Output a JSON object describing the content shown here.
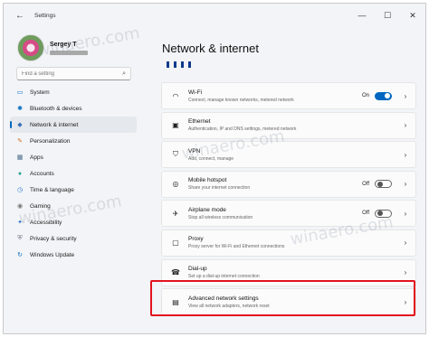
{
  "window": {
    "back_icon": "←",
    "title": "Settings",
    "minimize_icon": "—",
    "maximize_icon": "☐",
    "close_icon": "✕"
  },
  "profile": {
    "name": "Sergey T"
  },
  "search": {
    "placeholder": "Find a setting",
    "icon": "⌕"
  },
  "sidebar": {
    "items": [
      {
        "label": "System",
        "icon": "▭",
        "icon_color": "#0067c0"
      },
      {
        "label": "Bluetooth & devices",
        "icon": "✱",
        "icon_color": "#0067c0"
      },
      {
        "label": "Network & internet",
        "icon": "◆",
        "icon_color": "#3b6fb6"
      },
      {
        "label": "Personalization",
        "icon": "✎",
        "icon_color": "#d4762c"
      },
      {
        "label": "Apps",
        "icon": "▦",
        "icon_color": "#4b6a88"
      },
      {
        "label": "Accounts",
        "icon": "●",
        "icon_color": "#2aa38e"
      },
      {
        "label": "Time & language",
        "icon": "◷",
        "icon_color": "#2c7ad6"
      },
      {
        "label": "Gaming",
        "icon": "◉",
        "icon_color": "#777777"
      },
      {
        "label": "Accessibility",
        "icon": "✦",
        "icon_color": "#3d76c8"
      },
      {
        "label": "Privacy & security",
        "icon": "⛨",
        "icon_color": "#6b7480"
      },
      {
        "label": "Windows Update",
        "icon": "↻",
        "icon_color": "#0067c0"
      }
    ]
  },
  "main": {
    "title": "Network & internet",
    "cards": [
      {
        "title": "Wi-Fi",
        "subtitle": "Connect, manage known networks, metered network",
        "icon": "◠",
        "toggle": "on",
        "toggle_label": "On",
        "chevron": "›"
      },
      {
        "title": "Ethernet",
        "subtitle": "Authentication, IP and DNS settings, metered network",
        "icon": "▣",
        "chevron": "›"
      },
      {
        "title": "VPN",
        "subtitle": "Add, connect, manage",
        "icon": "⛉",
        "chevron": "›"
      },
      {
        "title": "Mobile hotspot",
        "subtitle": "Share your internet connection",
        "icon": "◎",
        "toggle": "off",
        "toggle_label": "Off",
        "chevron": "›"
      },
      {
        "title": "Airplane mode",
        "subtitle": "Stop all wireless communication",
        "icon": "✈",
        "toggle": "off",
        "toggle_label": "Off",
        "chevron": "›"
      },
      {
        "title": "Proxy",
        "subtitle": "Proxy server for Wi-Fi and Ethernet connections",
        "icon": "▢",
        "chevron": "›"
      },
      {
        "title": "Dial-up",
        "subtitle": "Set up a dial-up internet connection",
        "icon": "☎",
        "chevron": "›"
      },
      {
        "title": "Advanced network settings",
        "subtitle": "View all network adapters, network reset",
        "icon": "▤",
        "chevron": "›"
      }
    ]
  },
  "watermark": "winaero.com",
  "colors": {
    "accent": "#0067c0",
    "highlight": "#e3131d"
  }
}
